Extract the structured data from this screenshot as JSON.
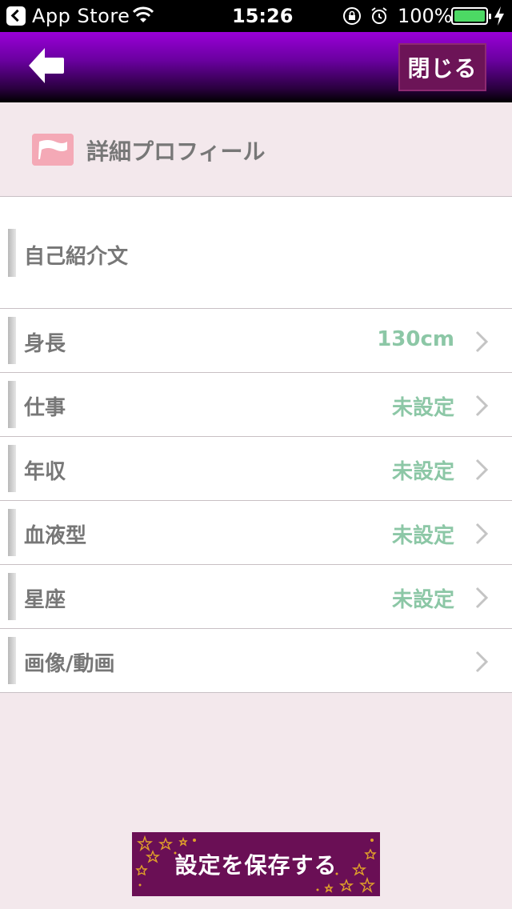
{
  "status_bar": {
    "back_app_label": "App Store",
    "time": "15:26",
    "battery_percent": "100%",
    "icons": [
      "back-to-app-icon",
      "wifi-icon",
      "rotation-lock-icon",
      "alarm-icon",
      "battery-icon",
      "charging-bolt-icon"
    ]
  },
  "header": {
    "back_icon": "back-arrow-icon",
    "close_label": "閉じる"
  },
  "section": {
    "icon": "flag-icon",
    "title": "詳細プロフィール"
  },
  "rows": [
    {
      "label": "自己紹介文",
      "value": ""
    },
    {
      "label": "身長",
      "value": "130cm"
    },
    {
      "label": "仕事",
      "value": "未設定"
    },
    {
      "label": "年収",
      "value": "未設定"
    },
    {
      "label": "血液型",
      "value": "未設定"
    },
    {
      "label": "星座",
      "value": "未設定"
    },
    {
      "label": "画像/動画",
      "value": ""
    }
  ],
  "save_button": {
    "label": "設定を保存する"
  },
  "colors": {
    "header_gradient_top": "#9a00d8",
    "button_bg": "#6a0f55",
    "value_text": "#8cc7a6",
    "label_text": "#777777",
    "page_bg": "#f3e8ec",
    "flag_pink": "#f4a9b6"
  }
}
